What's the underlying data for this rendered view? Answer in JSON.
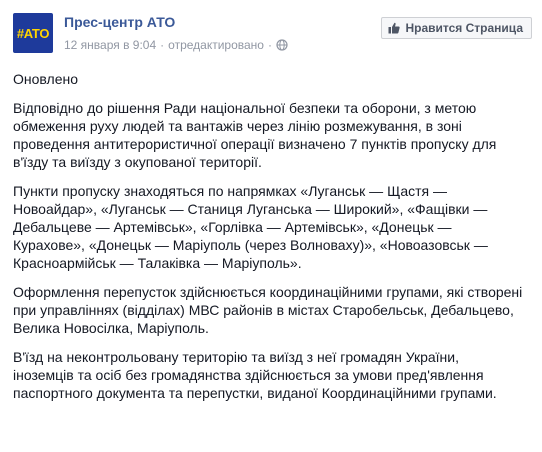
{
  "header": {
    "avatar_text": "#ATO",
    "page_name": "Прес-центр АТО",
    "date": "12 января в 9:04",
    "separator": "·",
    "edited": "отредактировано",
    "like_button_label": "Нравится Страница"
  },
  "post": {
    "paragraphs": [
      "Оновлено",
      "Відповідно до рішення Ради національної безпеки та оборони, з метою обмеження руху людей та вантажів через лінію розмежування, в зоні проведення антитерористичної операції визначено 7 пунктів пропуску для в'їзду та виїзду з окупованої території.",
      "Пункти пропуску знаходяться по напрямках «Луганськ — Щастя — Новоайдар», «Луганськ — Станиця Луганська — Широкий», «Фащівки — Дебальцеве — Артемівськ», «Горлівка — Артемівськ», «Донецьк — Курахове», «Донецьк — Маріуполь (через Волноваху)», «Новоазовськ — Красноармійськ — Талаківка — Маріуполь».",
      "Оформлення перепусток здійснюється координаційними групами, які створені при управліннях (відділах) МВС районів в містах Старобельськ, Дебальцево, Велика Новосілка, Маріуполь.",
      "В'їзд на неконтрольовану територію та виїзд з неї громадян України, іноземців та осіб без громадянства здійснюється за умови пред'явлення паспортного документа та перепустки, виданої Координаційними групами."
    ]
  },
  "colors": {
    "link": "#3b5998",
    "meta": "#9197a3",
    "text": "#141823",
    "avatar_bg": "#1e3a9b",
    "avatar_fg": "#ffd400"
  },
  "icons": {
    "globe": "globe-icon",
    "thumb": "thumbs-up-icon"
  }
}
